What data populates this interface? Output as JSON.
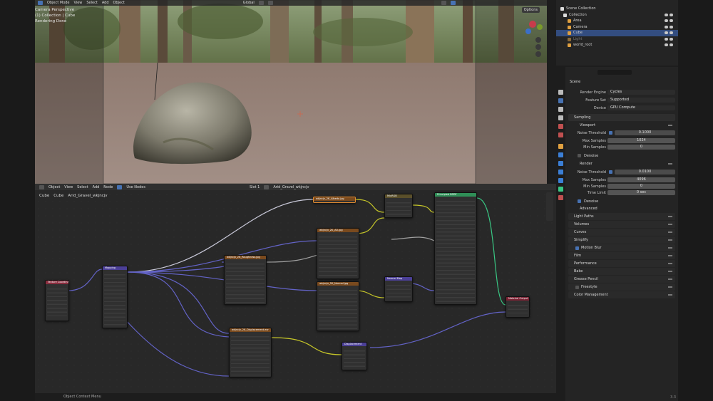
{
  "viewport": {
    "header": {
      "mode": "Object Mode",
      "menus": [
        "View",
        "Select",
        "Add",
        "Object"
      ],
      "orientation": "Global",
      "options_label": "Options"
    },
    "info": {
      "line1": "Camera Perspective",
      "line2": "(1) Collection | Cube",
      "line3": "Rendering Done"
    }
  },
  "node_editor": {
    "header": {
      "editor_type": "Object",
      "menus": [
        "View",
        "Select",
        "Add",
        "Node"
      ],
      "use_nodes_label": "Use Nodes",
      "slot": "Slot 1",
      "material": "Arid_Gravel_wkjncjv"
    },
    "breadcrumb": [
      "Cube",
      "Cube",
      "Arid_Gravel_wkjncjv"
    ],
    "status_text": "Object Context Menu",
    "nodes": [
      {
        "title": "Texture Coordinate"
      },
      {
        "title": "Mapping"
      },
      {
        "title": "wkjncjv_2K_Albedo.jpg"
      },
      {
        "title": "wkjncjv_2K_AO.jpg"
      },
      {
        "title": "wkjncjv_2K_Roughness.jpg"
      },
      {
        "title": "wkjncjv_2K_Normal.jpg"
      },
      {
        "title": "wkjncjv_2K_Displacement.exr"
      },
      {
        "title": "Normal Map"
      },
      {
        "title": "MixRGB"
      },
      {
        "title": "Principled BSDF"
      },
      {
        "title": "Displacement"
      },
      {
        "title": "Material Output"
      }
    ]
  },
  "outliner": {
    "title": "Scene Collection",
    "items": [
      {
        "label": "Collection"
      },
      {
        "label": "Area"
      },
      {
        "label": "Camera"
      },
      {
        "label": "Cube"
      },
      {
        "label": "Light"
      },
      {
        "label": "world_root"
      }
    ]
  },
  "properties": {
    "breadcrumb": "Scene",
    "render_engine": {
      "label": "Render Engine",
      "value": "Cycles"
    },
    "feature_set": {
      "label": "Feature Set",
      "value": "Supported"
    },
    "device": {
      "label": "Device",
      "value": "GPU Compute"
    },
    "sampling": {
      "title": "Sampling",
      "viewport": {
        "title": "Viewport",
        "noise_threshold": {
          "label": "Noise Threshold",
          "value": "0.1000"
        },
        "max_samples": {
          "label": "Max Samples",
          "value": "1024"
        },
        "min_samples": {
          "label": "Min Samples",
          "value": "0"
        },
        "denoise": "Denoise"
      },
      "render": {
        "title": "Render",
        "noise_threshold": {
          "label": "Noise Threshold",
          "value": "0.0100"
        },
        "max_samples": {
          "label": "Max Samples",
          "value": "4096"
        },
        "min_samples": {
          "label": "Min Samples",
          "value": "0"
        },
        "time_limit": {
          "label": "Time Limit",
          "value": "0 sec"
        },
        "denoise": "Denoise"
      },
      "advanced": "Advanced"
    },
    "panels": [
      "Light Paths",
      "Volumes",
      "Curves",
      "Simplify",
      "Motion Blur",
      "Film",
      "Performance",
      "Bake",
      "Grease Pencil",
      "Freestyle",
      "Color Management"
    ]
  },
  "status_bar": {
    "version": "3.3"
  },
  "colors": {
    "accent": "#4772b3",
    "selection": "#334d80",
    "node_image": "#7a4a1e",
    "node_shader": "#2f8f57",
    "node_vector": "#4b3f96",
    "node_input": "#8a2e3f",
    "node_output": "#7a2233"
  }
}
